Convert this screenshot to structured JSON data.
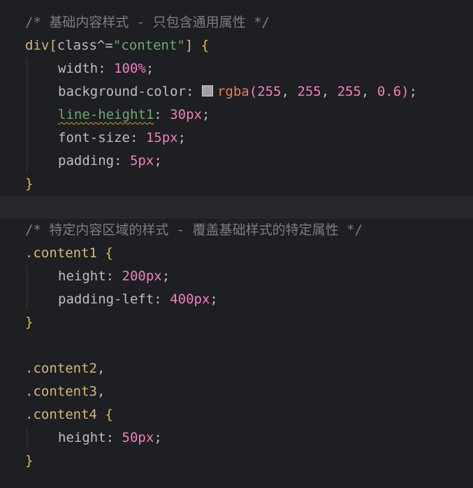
{
  "editor": {
    "comment1": "/* 基础内容样式 - 只包含通用属性 */",
    "rule1": {
      "selector_tag": "div",
      "selector_open": "[",
      "selector_attr": "class",
      "selector_op": "^=",
      "selector_value": "\"content\"",
      "selector_close": "]",
      "open_brace": "{",
      "close_brace": "}",
      "decls": [
        {
          "prop": "width",
          "value": "100%"
        },
        {
          "prop": "background-color",
          "fn": "rgba",
          "args": [
            "255",
            "255",
            "255",
            "0.6"
          ],
          "swatch_color": "rgba(255, 255, 255, 0.6)"
        },
        {
          "prop": "line-height1",
          "value": "30px"
        },
        {
          "prop": "font-size",
          "value": "15px"
        },
        {
          "prop": "padding",
          "value": "5px"
        }
      ]
    },
    "comment2": "/* 特定内容区域的样式 - 覆盖基础样式的特定属性 */",
    "rule2": {
      "selector": ".content1",
      "open_brace": "{",
      "close_brace": "}",
      "decls": [
        {
          "prop": "height",
          "value": "200px"
        },
        {
          "prop": "padding-left",
          "value": "400px"
        }
      ]
    },
    "rule3": {
      "selectors": [
        ".content2,",
        ".content3,",
        ".content4"
      ],
      "open_brace": "{",
      "close_brace": "}",
      "decls": [
        {
          "prop": "height",
          "value": "50px"
        }
      ]
    },
    "colon": ":",
    "semicolon": ";",
    "comma": ", ",
    "paren_open": "(",
    "paren_close": ")",
    "colors": {
      "background": "#1e1f22",
      "current_line": "#26282e",
      "comment": "#7a7e85",
      "selector": "#d5b778",
      "string": "#6aab73",
      "number": "#f47ebf",
      "function": "#f27a4f",
      "brace": "#e8ba36"
    }
  }
}
